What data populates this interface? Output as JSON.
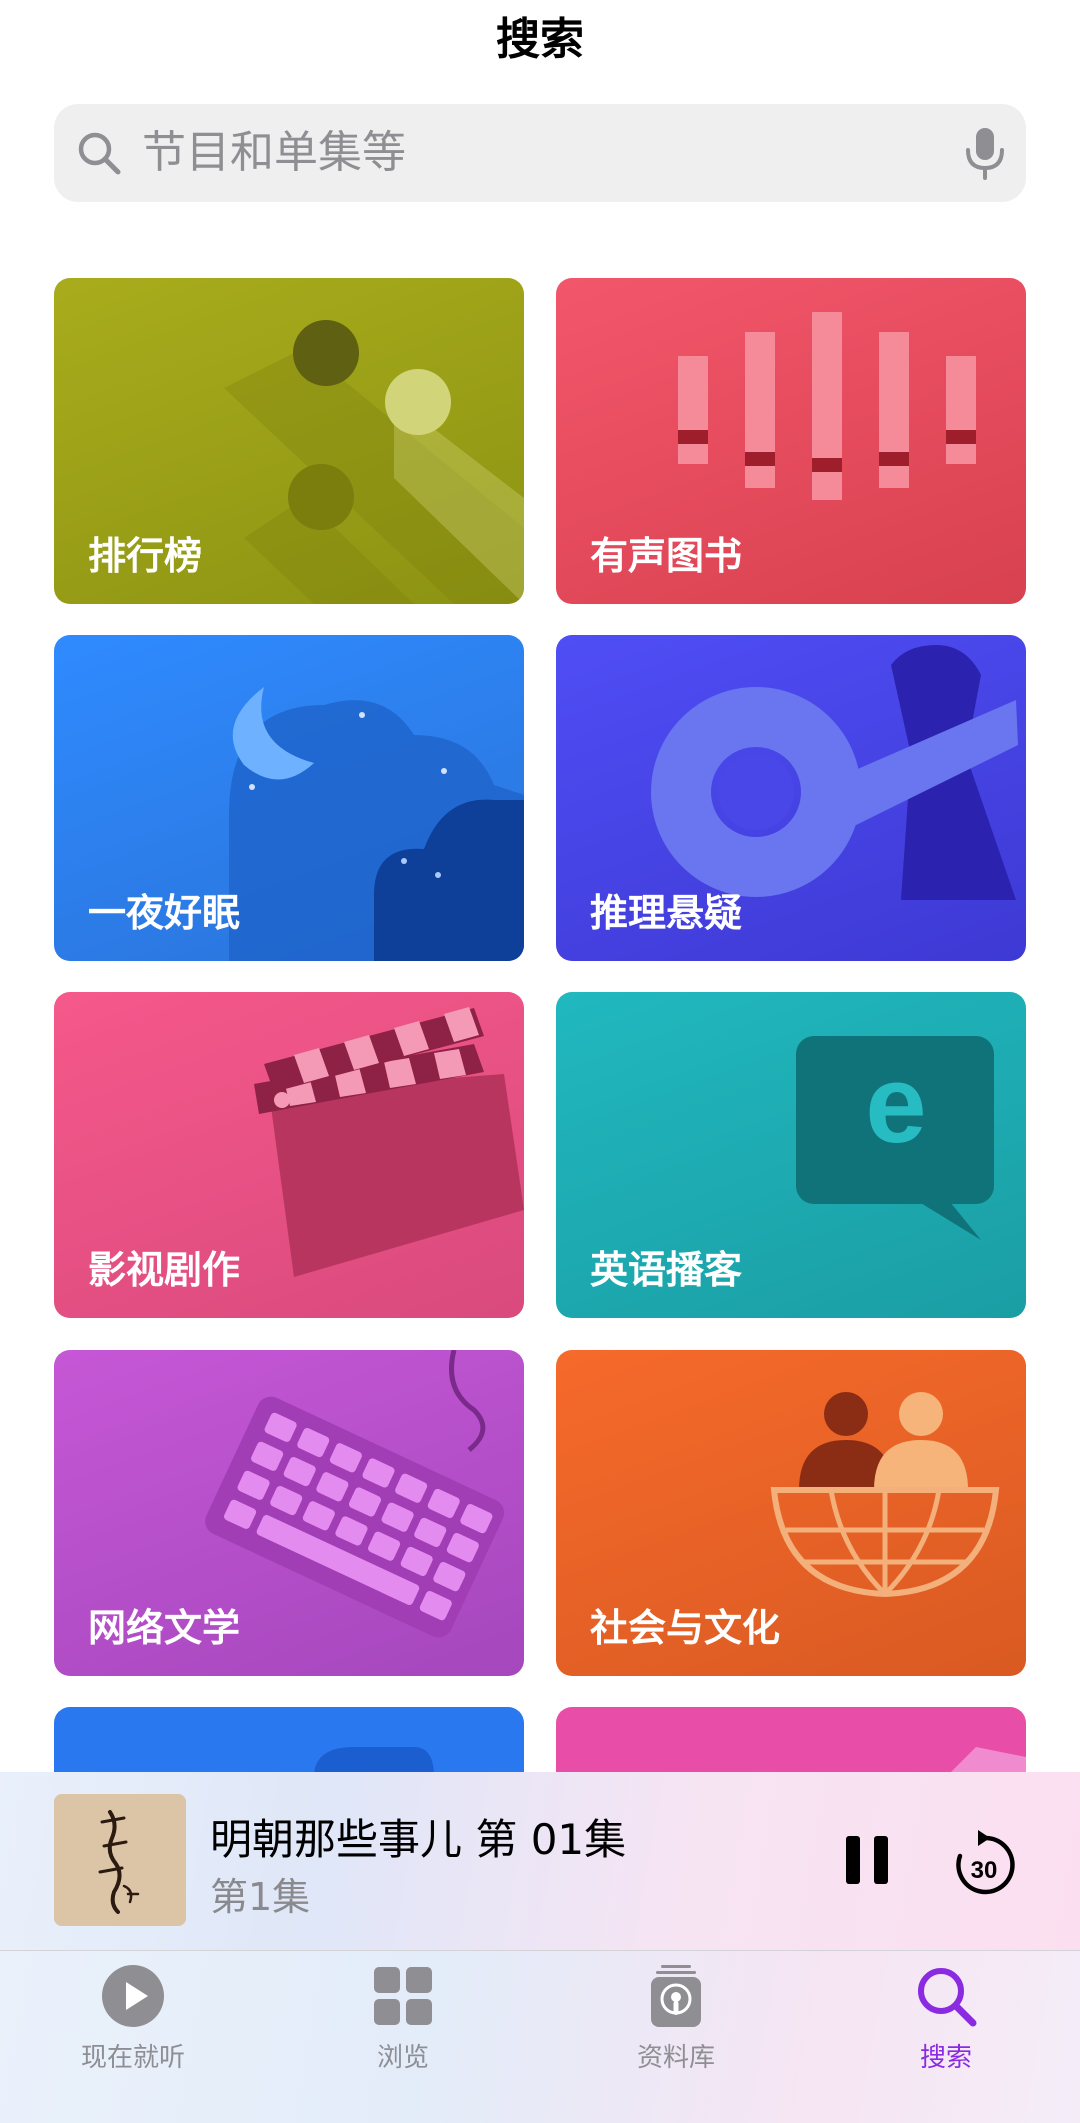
{
  "header": {
    "title": "搜索"
  },
  "search": {
    "placeholder": "节目和单集等"
  },
  "categories": [
    {
      "label": "排行榜"
    },
    {
      "label": "有声图书"
    },
    {
      "label": "一夜好眠"
    },
    {
      "label": "推理悬疑"
    },
    {
      "label": "影视剧作"
    },
    {
      "label": "英语播客"
    },
    {
      "label": "网络文学"
    },
    {
      "label": "社会与文化"
    }
  ],
  "now_playing": {
    "title": "明朝那些事儿 第 01集",
    "subtitle": "第1集",
    "skip_seconds": "30"
  },
  "tabs": [
    {
      "label": "现在就听",
      "icon": "play-circle-icon"
    },
    {
      "label": "浏览",
      "icon": "grid-icon"
    },
    {
      "label": "资料库",
      "icon": "library-icon"
    },
    {
      "label": "搜索",
      "icon": "search-icon"
    }
  ],
  "colors": {
    "active_tab": "#8a2be2",
    "inactive_tab": "#8e8e93"
  }
}
